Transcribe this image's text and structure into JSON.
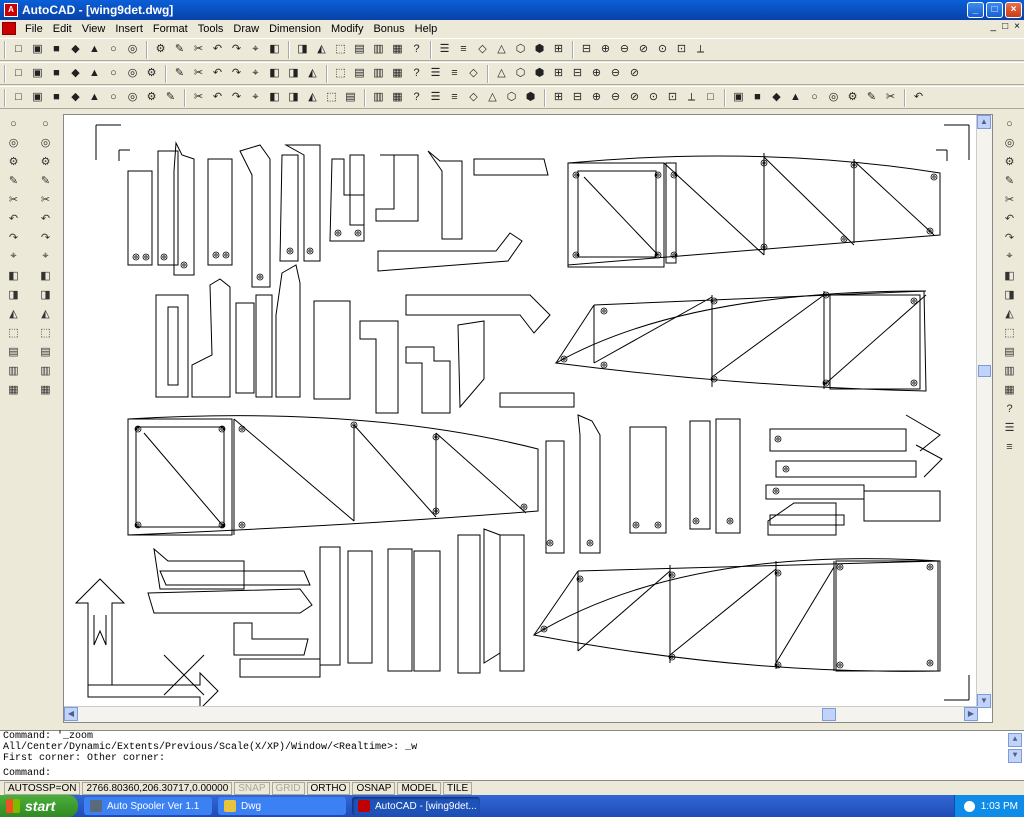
{
  "window": {
    "title": "AutoCAD - [wing9det.dwg]",
    "app_icon_label": "A"
  },
  "menu": {
    "items": [
      "File",
      "Edit",
      "View",
      "Insert",
      "Format",
      "Tools",
      "Draw",
      "Dimension",
      "Modify",
      "Bonus",
      "Help"
    ],
    "mdi_buttons": [
      "_",
      "□",
      "×"
    ]
  },
  "toolbars": {
    "standard": [
      "new-icon",
      "open-icon",
      "save-icon",
      "print-icon",
      "preview-icon",
      "spellcheck-icon",
      "cut-icon",
      "copy-icon",
      "paste-icon",
      "match-prop-icon",
      "undo-icon",
      "redo-icon",
      "hyperlink-icon",
      "snap-icon",
      "ucs-icon",
      "distance-icon",
      "pan-icon",
      "zoom-realtime-icon",
      "zoom-window-icon",
      "zoom-previous-icon",
      "help-icon",
      "layer-icon",
      "properties-icon",
      "linetype-icon",
      "lineweight-icon",
      "3d-box-icon",
      "3d-wedge-icon",
      "3d-cone-icon",
      "3d-sphere-icon",
      "3d-torus-icon",
      "3d-cylinder-icon",
      "render-icon",
      "shade-icon",
      "hide-icon",
      "material-icon"
    ],
    "row2": [
      "snap-endpoint-icon",
      "snap-midpoint-icon",
      "snap-intersection-icon",
      "snap-center-icon",
      "snap-quadrant-icon",
      "snap-tangent-icon",
      "snap-perpendicular-icon",
      "snap-node-icon",
      "snap-insert-icon",
      "snap-nearest-icon",
      "snap-none-icon",
      "snap-settings-icon",
      "view-top-icon",
      "view-bottom-icon",
      "view-left-icon",
      "view-right-icon",
      "view-front-icon",
      "view-back-icon",
      "view-iso-icon",
      "block-icon",
      "insert-block-icon",
      "attribute-icon",
      "xref-icon",
      "image-icon",
      "ole-icon",
      "text-style-icon",
      "dim-style-icon",
      "plot-style-icon",
      "design-center-icon",
      "tool-palette-icon",
      "markup-icon",
      "calc-icon"
    ],
    "row3": [
      "ucs-world-icon",
      "ucs-object-icon",
      "ucs-face-icon",
      "ucs-view-icon",
      "ucs-origin-icon",
      "ucs-zaxis-icon",
      "ucs-3point-icon",
      "ucs-x-icon",
      "ucs-y-icon",
      "ucs-z-icon",
      "box-icon",
      "sphere-icon",
      "cylinder-icon",
      "cone-icon",
      "wedge-icon",
      "torus-icon",
      "extrude-icon",
      "revolve-icon",
      "slice-icon",
      "section-icon",
      "interfere-icon",
      "setup-view-icon",
      "setup-drawing-icon",
      "setup-profile-icon",
      "zoom-window-icon",
      "zoom-dynamic-icon",
      "zoom-scale-icon",
      "zoom-center-icon",
      "zoom-in-icon",
      "zoom-out-icon",
      "zoom-all-icon",
      "zoom-extents-icon",
      "dim-linear-icon",
      "dim-aligned-icon",
      "dim-ordinate-icon",
      "dim-radius-icon",
      "dim-diameter-icon",
      "dim-angular-icon",
      "dim-baseline-icon",
      "dim-continue-icon",
      "leader-icon",
      "tolerance-icon",
      "center-mark-icon",
      "dim-edit-icon",
      "dim-text-edit-icon",
      "dim-update-icon"
    ]
  },
  "left_toolbar": {
    "draw": [
      "line-icon",
      "construction-line-icon",
      "polyline-icon",
      "polygon-icon",
      "rectangle-icon",
      "arc-icon",
      "circle-icon",
      "spline-icon",
      "ellipse-icon",
      "insert-block-icon",
      "make-block-icon",
      "point-icon",
      "hatch-icon",
      "region-icon",
      "text-icon"
    ],
    "modify": [
      "erase-icon",
      "copy-object-icon",
      "mirror-icon",
      "offset-icon",
      "array-icon",
      "move-icon",
      "rotate-icon",
      "scale-icon",
      "stretch-icon",
      "trim-icon",
      "extend-icon",
      "break-icon",
      "chamfer-icon",
      "fillet-icon",
      "explode-icon"
    ]
  },
  "right_toolbar": [
    "snap-from-icon",
    "snap-endpoint-icon",
    "snap-midpoint-icon",
    "snap-intersection-icon",
    "snap-center-icon",
    "snap-quadrant-icon",
    "snap-tangent-icon",
    "snap-perpendicular-icon",
    "snap-node-icon",
    "snap-insert-icon",
    "snap-nearest-icon",
    "snap-none-icon",
    "layer-prev-icon",
    "layer-icon",
    "plot-icon",
    "table-icon",
    "properties-icon",
    "design-center-icon"
  ],
  "command": {
    "lines": [
      "Command: '_zoom",
      "All/Center/Dynamic/Extents/Previous/Scale(X/XP)/Window/<Realtime>: _w",
      "First corner: Other corner:"
    ],
    "prompt": "Command:"
  },
  "status": {
    "autosnap": "AUTOSSP=ON",
    "coords": "2766.80360,206.30717,0.00000",
    "toggles": [
      {
        "label": "SNAP",
        "active": false
      },
      {
        "label": "GRID",
        "active": false
      },
      {
        "label": "ORTHO",
        "active": true
      },
      {
        "label": "OSNAP",
        "active": true
      },
      {
        "label": "MODEL",
        "active": true
      },
      {
        "label": "TILE",
        "active": true
      }
    ]
  },
  "taskbar": {
    "start_label": "start",
    "tasks": [
      {
        "label": "Auto Spooler Ver 1.1",
        "color": "#5a6a7a",
        "active": false
      },
      {
        "label": "Dwg",
        "color": "#e8c43c",
        "active": false
      },
      {
        "label": "AutoCAD - [wing9det...",
        "color": "#c00000",
        "active": true
      }
    ],
    "clock": "1:03 PM"
  }
}
